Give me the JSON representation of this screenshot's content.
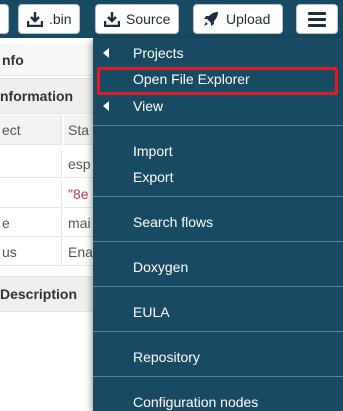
{
  "header": {
    "bin_label": ".bin",
    "source_label": "Source",
    "upload_label": "Upload"
  },
  "info_panel": {
    "title": "nfo",
    "section_information": "nformation",
    "column_1_header": "ect",
    "column_2_header": "Sta",
    "rows": [
      {
        "c1": "",
        "c2": "esp"
      },
      {
        "c1": "",
        "c2": "\"8e"
      },
      {
        "c1": "e",
        "c2": "mai"
      },
      {
        "c1": "us",
        "c2": "Ena"
      }
    ],
    "section_description": "Description"
  },
  "menu": {
    "items": [
      {
        "label": "Projects"
      },
      {
        "label": "Open File Explorer"
      },
      {
        "label": "View"
      },
      {
        "label": "Import"
      },
      {
        "label": "Export"
      },
      {
        "label": "Search flows"
      },
      {
        "label": "Doxygen"
      },
      {
        "label": "EULA"
      },
      {
        "label": "Repository"
      },
      {
        "label": "Configuration nodes"
      }
    ]
  },
  "colors": {
    "header_bg": "#184a63",
    "menu_bg": "#184a63",
    "highlight_border": "#e11b22",
    "value_red": "#c43c3c"
  }
}
